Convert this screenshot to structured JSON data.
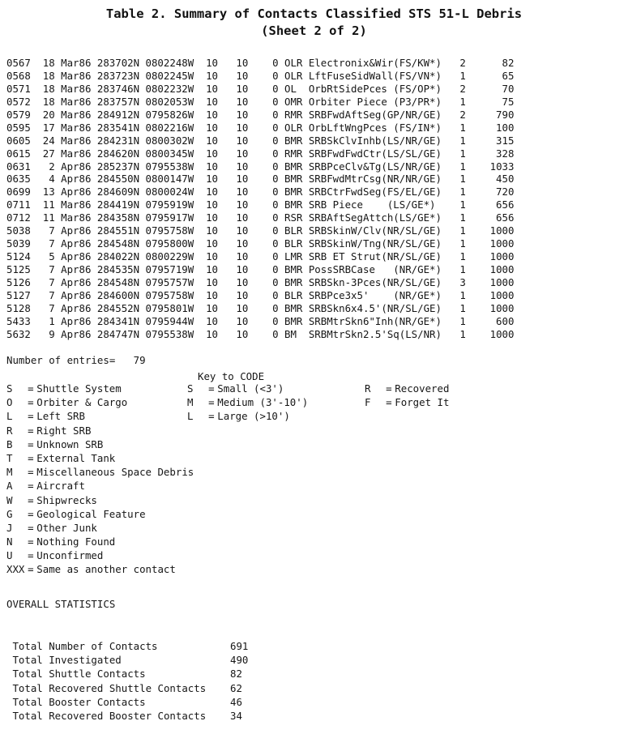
{
  "title": {
    "line1": "Table 2.  Summary of Contacts Classified STS 51-L Debris",
    "line2": "(Sheet 2 of 2)"
  },
  "table": {
    "rows": [
      {
        "id": "0567",
        "day": "18",
        "month": "Mar86",
        "lat": "283702N",
        "lon": "0802248W",
        "n1": "10",
        "n2": "10",
        "n3": "0",
        "code": "OLR",
        "desc": "Electronix&Wir(FS/KW*)",
        "qty": "2",
        "size": "82"
      },
      {
        "id": "0568",
        "day": "18",
        "month": "Mar86",
        "lat": "283723N",
        "lon": "0802245W",
        "n1": "10",
        "n2": "10",
        "n3": "0",
        "code": "OLR",
        "desc": "LftFuseSidWall(FS/VN*)",
        "qty": "1",
        "size": "65"
      },
      {
        "id": "0571",
        "day": "18",
        "month": "Mar86",
        "lat": "283746N",
        "lon": "0802232W",
        "n1": "10",
        "n2": "10",
        "n3": "0",
        "code": "OL",
        "desc": "OrbRtSidePces (FS/OP*)",
        "qty": "2",
        "size": "70"
      },
      {
        "id": "0572",
        "day": "18",
        "month": "Mar86",
        "lat": "283757N",
        "lon": "0802053W",
        "n1": "10",
        "n2": "10",
        "n3": "0",
        "code": "OMR",
        "desc": "Orbiter Piece (P3/PR*)",
        "qty": "1",
        "size": "75"
      },
      {
        "id": "0579",
        "day": "20",
        "month": "Mar86",
        "lat": "284912N",
        "lon": "0795826W",
        "n1": "10",
        "n2": "10",
        "n3": "0",
        "code": "RMR",
        "desc": "SRBFwdAftSeg(GP/NR/GE)",
        "qty": "2",
        "size": "790"
      },
      {
        "id": "0595",
        "day": "17",
        "month": "Mar86",
        "lat": "283541N",
        "lon": "0802216W",
        "n1": "10",
        "n2": "10",
        "n3": "0",
        "code": "OLR",
        "desc": "OrbLftWngPces (FS/IN*)",
        "qty": "1",
        "size": "100"
      },
      {
        "id": "0605",
        "day": "24",
        "month": "Mar86",
        "lat": "284231N",
        "lon": "0800302W",
        "n1": "10",
        "n2": "10",
        "n3": "0",
        "code": "BMR",
        "desc": "SRBSkClvInhb(LS/NR/GE)",
        "qty": "1",
        "size": "315"
      },
      {
        "id": "0615",
        "day": "27",
        "month": "Mar86",
        "lat": "284620N",
        "lon": "0800345W",
        "n1": "10",
        "n2": "10",
        "n3": "0",
        "code": "RMR",
        "desc": "SRBFwdFwdCtr(LS/SL/GE)",
        "qty": "1",
        "size": "328"
      },
      {
        "id": "0631",
        "day": "2",
        "month": "Apr86",
        "lat": "285237N",
        "lon": "0795538W",
        "n1": "10",
        "n2": "10",
        "n3": "0",
        "code": "BMR",
        "desc": "SRBPceClv&Tg(LS/NR/GE)",
        "qty": "1",
        "size": "1033"
      },
      {
        "id": "0635",
        "day": "4",
        "month": "Apr86",
        "lat": "284550N",
        "lon": "0800147W",
        "n1": "10",
        "n2": "10",
        "n3": "0",
        "code": "BMR",
        "desc": "SRBFwdMtrCsg(NR/NR/GE)",
        "qty": "1",
        "size": "450"
      },
      {
        "id": "0699",
        "day": "13",
        "month": "Apr86",
        "lat": "284609N",
        "lon": "0800024W",
        "n1": "10",
        "n2": "10",
        "n3": "0",
        "code": "BMR",
        "desc": "SRBCtrFwdSeg(FS/EL/GE)",
        "qty": "1",
        "size": "720"
      },
      {
        "id": "0711",
        "day": "11",
        "month": "Mar86",
        "lat": "284419N",
        "lon": "0795919W",
        "n1": "10",
        "n2": "10",
        "n3": "0",
        "code": "BMR",
        "desc": "SRB Piece    (LS/GE*)",
        "qty": "1",
        "size": "656"
      },
      {
        "id": "0712",
        "day": "11",
        "month": "Mar86",
        "lat": "284358N",
        "lon": "0795917W",
        "n1": "10",
        "n2": "10",
        "n3": "0",
        "code": "RSR",
        "desc": "SRBAftSegAttch(LS/GE*)",
        "qty": "1",
        "size": "656"
      },
      {
        "id": "5038",
        "day": "7",
        "month": "Apr86",
        "lat": "284551N",
        "lon": "0795758W",
        "n1": "10",
        "n2": "10",
        "n3": "0",
        "code": "BLR",
        "desc": "SRBSkinW/Clv(NR/SL/GE)",
        "qty": "1",
        "size": "1000"
      },
      {
        "id": "5039",
        "day": "7",
        "month": "Apr86",
        "lat": "284548N",
        "lon": "0795800W",
        "n1": "10",
        "n2": "10",
        "n3": "0",
        "code": "BLR",
        "desc": "SRBSkinW/Tng(NR/SL/GE)",
        "qty": "1",
        "size": "1000"
      },
      {
        "id": "5124",
        "day": "5",
        "month": "Apr86",
        "lat": "284022N",
        "lon": "0800229W",
        "n1": "10",
        "n2": "10",
        "n3": "0",
        "code": "LMR",
        "desc": "SRB ET Strut(NR/SL/GE)",
        "qty": "1",
        "size": "1000"
      },
      {
        "id": "5125",
        "day": "7",
        "month": "Apr86",
        "lat": "284535N",
        "lon": "0795719W",
        "n1": "10",
        "n2": "10",
        "n3": "0",
        "code": "BMR",
        "desc": "PossSRBCase   (NR/GE*)",
        "qty": "1",
        "size": "1000"
      },
      {
        "id": "5126",
        "day": "7",
        "month": "Apr86",
        "lat": "284548N",
        "lon": "0795757W",
        "n1": "10",
        "n2": "10",
        "n3": "0",
        "code": "BMR",
        "desc": "SRBSkn-3Pces(NR/SL/GE)",
        "qty": "3",
        "size": "1000"
      },
      {
        "id": "5127",
        "day": "7",
        "month": "Apr86",
        "lat": "284600N",
        "lon": "0795758W",
        "n1": "10",
        "n2": "10",
        "n3": "0",
        "code": "BLR",
        "desc": "SRBPce3x5'    (NR/GE*)",
        "qty": "1",
        "size": "1000"
      },
      {
        "id": "5128",
        "day": "7",
        "month": "Apr86",
        "lat": "284552N",
        "lon": "0795801W",
        "n1": "10",
        "n2": "10",
        "n3": "0",
        "code": "BMR",
        "desc": "SRBSkn6x4.5'(NR/SL/GE)",
        "qty": "1",
        "size": "1000"
      },
      {
        "id": "5433",
        "day": "1",
        "month": "Apr86",
        "lat": "284341N",
        "lon": "0795944W",
        "n1": "10",
        "n2": "10",
        "n3": "0",
        "code": "BMR",
        "desc": "SRBMtrSkn6\"Inh(NR/GE*)",
        "qty": "1",
        "size": "600"
      },
      {
        "id": "5632",
        "day": "9",
        "month": "Apr86",
        "lat": "284747N",
        "lon": "0795538W",
        "n1": "10",
        "n2": "10",
        "n3": "0",
        "code": "BM",
        "desc": "SRBMtrSkn2.5'Sq(LS/NR)",
        "qty": "1",
        "size": "1000"
      }
    ]
  },
  "entries": {
    "label": "Number of entries=",
    "count": "79"
  },
  "key": {
    "heading": "Key to CODE",
    "left_column": [
      {
        "key": "S",
        "eq": "=",
        "value": "Shuttle System"
      },
      {
        "key": "O",
        "eq": "=",
        "value": "Orbiter & Cargo"
      },
      {
        "key": "L",
        "eq": "=",
        "value": "Left SRB"
      },
      {
        "key": "R",
        "eq": "=",
        "value": "Right SRB"
      },
      {
        "key": "B",
        "eq": "=",
        "value": "Unknown SRB"
      },
      {
        "key": "T",
        "eq": "=",
        "value": "External Tank"
      },
      {
        "key": "M",
        "eq": "=",
        "value": "Miscellaneous Space Debris"
      },
      {
        "key": "A",
        "eq": "=",
        "value": "Aircraft"
      },
      {
        "key": "W",
        "eq": "=",
        "value": "Shipwrecks"
      },
      {
        "key": "G",
        "eq": "=",
        "value": "Geological Feature"
      },
      {
        "key": "J",
        "eq": "=",
        "value": "Other Junk"
      },
      {
        "key": "N",
        "eq": "=",
        "value": "Nothing Found"
      },
      {
        "key": "U",
        "eq": "=",
        "value": "Unconfirmed"
      },
      {
        "key": "XXX",
        "eq": "=",
        "value": "Same as another contact"
      }
    ],
    "middle_column": [
      {
        "key": "S",
        "eq": "=",
        "value": "Small (<3')"
      },
      {
        "key": "M",
        "eq": "=",
        "value": "Medium (3'-10')"
      },
      {
        "key": "L",
        "eq": "=",
        "value": "Large (>10')"
      }
    ],
    "right_column": [
      {
        "key": "R",
        "eq": "=",
        "value": "Recovered"
      },
      {
        "key": "F",
        "eq": "=",
        "value": "Forget It"
      }
    ]
  },
  "statistics": {
    "title": "OVERALL STATISTICS",
    "rows": [
      {
        "label": " Total Number of Contacts",
        "value": "691"
      },
      {
        "label": " Total Investigated",
        "value": "490"
      },
      {
        "label": " Total Shuttle Contacts",
        "value": "82"
      },
      {
        "label": " Total Recovered Shuttle Contacts",
        "value": "62"
      },
      {
        "label": " Total Booster Contacts",
        "value": "46"
      },
      {
        "label": " Total Recovered Booster Contacts",
        "value": "34"
      }
    ]
  }
}
